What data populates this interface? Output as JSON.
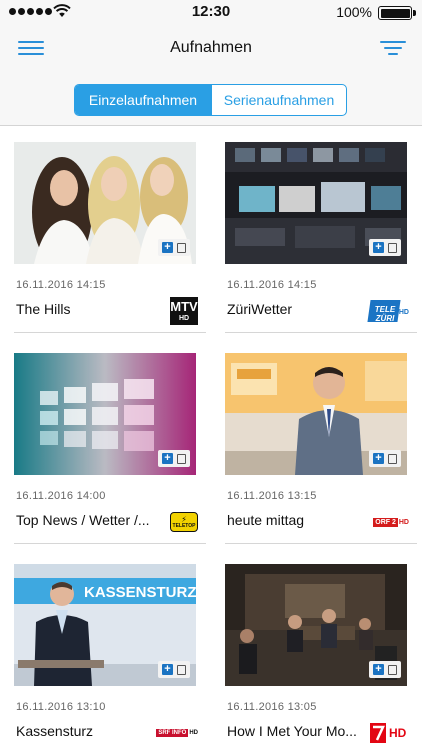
{
  "status_bar": {
    "time": "12:30",
    "battery_percent": "100%",
    "battery_level": 1.0
  },
  "nav": {
    "title": "Aufnahmen",
    "menu_icon": "hamburger-menu-icon",
    "filter_icon": "filter-icon"
  },
  "segments": {
    "single": "Einzelaufnahmen",
    "series": "Serienaufnahmen",
    "selected": "single"
  },
  "colors": {
    "accent": "#2a9fe4",
    "badge_blue": "#1a73c2",
    "background": "#ffffff",
    "bar_background": "#f7f7f7"
  },
  "recordings": [
    {
      "date": "16.11.2016 14:15",
      "title": "The Hills",
      "channel": "MTV",
      "channel_suffix": "HD",
      "thumb": "group-of-women"
    },
    {
      "date": "16.11.2016 14:15",
      "title": "ZüriWetter",
      "channel": "TELE ZÜRI",
      "channel_suffix": "HD",
      "thumb": "control-room"
    },
    {
      "date": "16.11.2016 14:00",
      "title": "Top News / Wetter /...",
      "channel": "TELETOP",
      "channel_suffix": "",
      "thumb": "video-wall"
    },
    {
      "date": "16.11.2016 13:15",
      "title": "heute mittag",
      "channel": "ORF 2",
      "channel_suffix": "HD",
      "thumb": "news-anchor"
    },
    {
      "date": "16.11.2016 13:10",
      "title": "Kassensturz",
      "channel": "SRF INFO",
      "channel_suffix": "HD",
      "thumb": "studio-presenter",
      "thumb_text": "KASSENSTURZ"
    },
    {
      "date": "16.11.2016 13:05",
      "title": "How I Met Your Mo...",
      "channel": "ProSieben",
      "channel_suffix": "HD",
      "thumb": "sitcom-set"
    }
  ]
}
